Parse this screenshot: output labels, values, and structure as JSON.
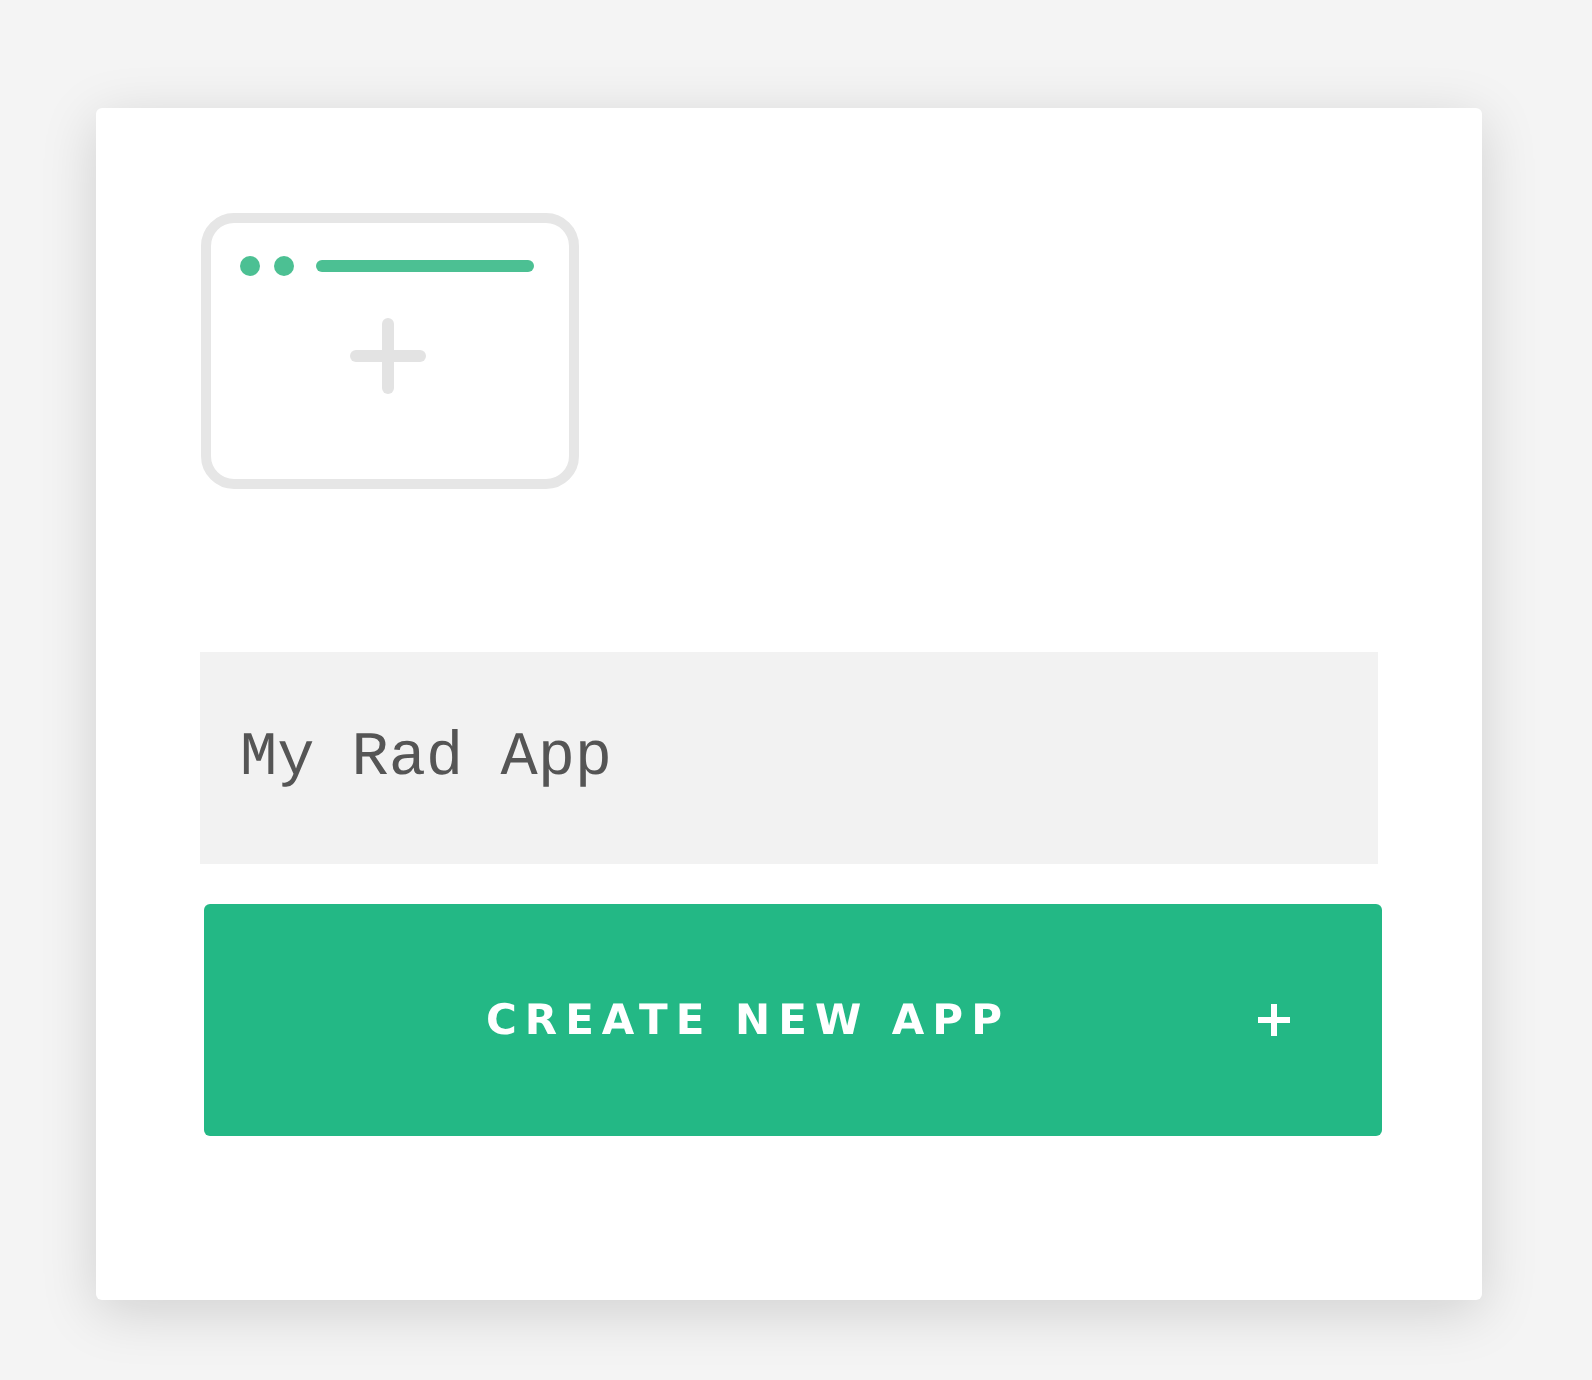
{
  "app_name_field": {
    "value": "My Rad App"
  },
  "create_button": {
    "label": "CREATE NEW APP"
  }
}
